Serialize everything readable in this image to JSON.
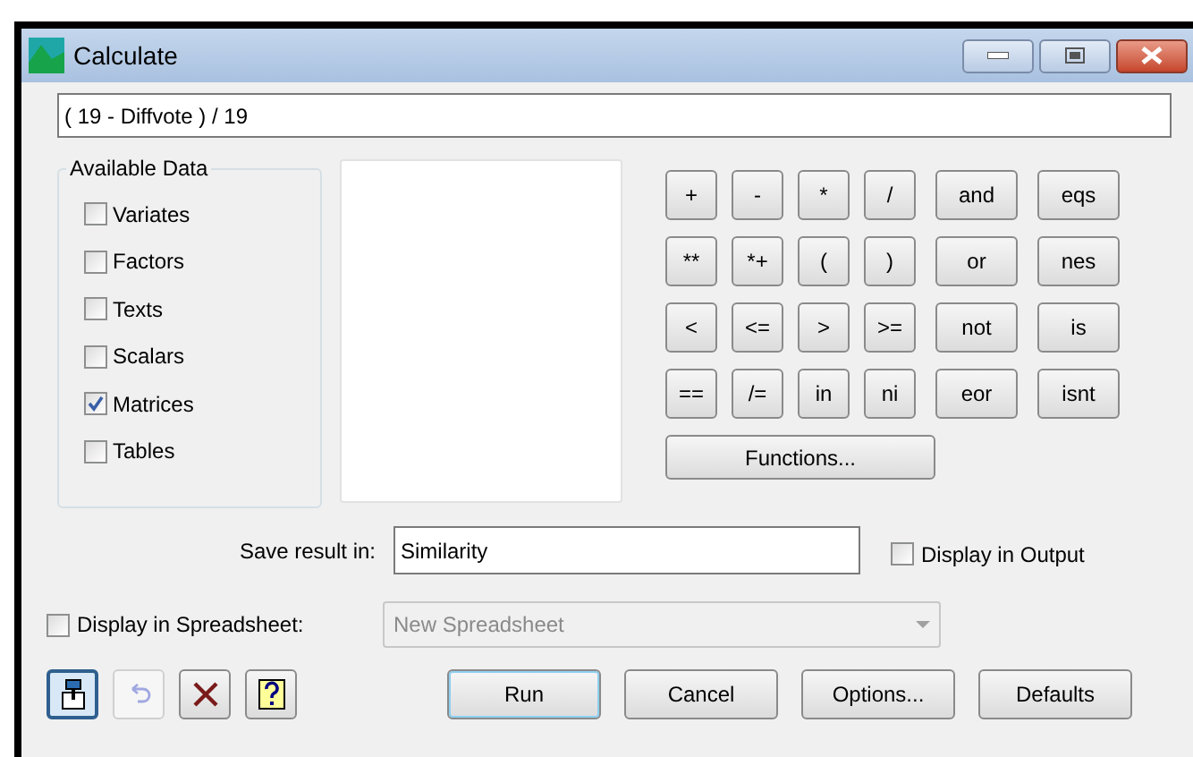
{
  "window": {
    "title": "Calculate"
  },
  "expression": {
    "value": "( 19 - Diffvote ) / 19"
  },
  "available_data": {
    "title": "Available Data",
    "items": [
      {
        "label": "Variates",
        "checked": false
      },
      {
        "label": "Factors",
        "checked": false
      },
      {
        "label": "Texts",
        "checked": false
      },
      {
        "label": "Scalars",
        "checked": false
      },
      {
        "label": "Matrices",
        "checked": true
      },
      {
        "label": "Tables",
        "checked": false
      }
    ]
  },
  "operators": [
    [
      "+",
      "-",
      "*",
      "/",
      "and",
      "eqs"
    ],
    [
      "**",
      "*+",
      "(",
      ")",
      "or",
      "nes"
    ],
    [
      "<",
      "<=",
      ">",
      ">=",
      "not",
      "is"
    ],
    [
      "==",
      "/=",
      "in",
      "ni",
      "eor",
      "isnt"
    ]
  ],
  "functions_button": "Functions...",
  "save_result": {
    "label": "Save result in:",
    "value": "Similarity"
  },
  "display_in_output": {
    "label": "Display in Output",
    "checked": false
  },
  "display_in_spreadsheet": {
    "label": "Display in Spreadsheet:",
    "checked": false,
    "value": "New Spreadsheet",
    "disabled": true
  },
  "tool_buttons": [
    {
      "kind": "pin",
      "disabled": false,
      "selected": true
    },
    {
      "kind": "undo",
      "disabled": true,
      "selected": false
    },
    {
      "kind": "clear",
      "disabled": false,
      "selected": false
    },
    {
      "kind": "help",
      "disabled": false,
      "selected": false
    }
  ],
  "buttons": [
    {
      "label": "Run",
      "default": true
    },
    {
      "label": "Cancel",
      "default": false
    },
    {
      "label": "Options...",
      "default": false
    },
    {
      "label": "Defaults",
      "default": false
    }
  ]
}
